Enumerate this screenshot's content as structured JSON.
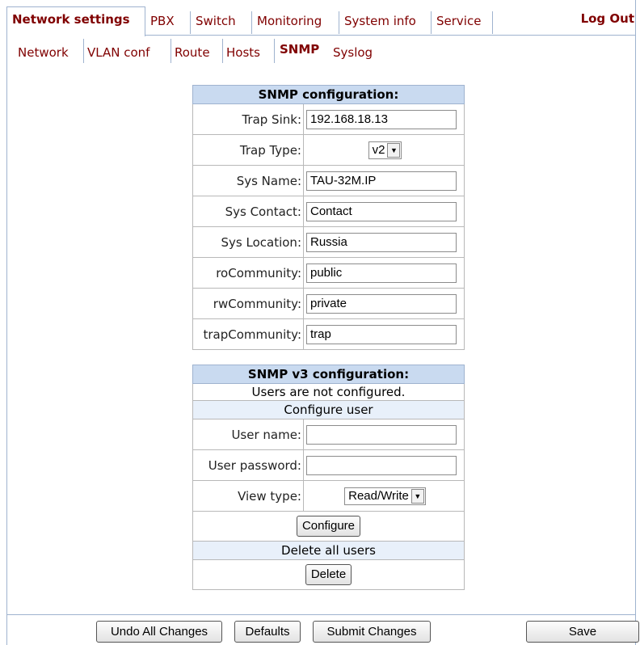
{
  "top_nav": {
    "tabs": [
      "Network settings",
      "PBX",
      "Switch",
      "Monitoring",
      "System info",
      "Service"
    ],
    "logout": "Log Out"
  },
  "sub_nav": {
    "tabs": [
      "Network",
      "VLAN conf",
      "Route",
      "Hosts",
      "SNMP",
      "Syslog"
    ]
  },
  "snmp": {
    "title": "SNMP configuration:",
    "trap_sink_label": "Trap Sink:",
    "trap_sink_value": "192.168.18.13",
    "trap_type_label": "Trap Type:",
    "trap_type_value": "v2",
    "sys_name_label": "Sys Name:",
    "sys_name_value": "TAU-32M.IP",
    "sys_contact_label": "Sys Contact:",
    "sys_contact_value": "Contact",
    "sys_location_label": "Sys Location:",
    "sys_location_value": "Russia",
    "ro_label": "roCommunity:",
    "ro_value": "public",
    "rw_label": "rwCommunity:",
    "rw_value": "private",
    "trap_comm_label": "trapCommunity:",
    "trap_comm_value": "trap"
  },
  "snmpv3": {
    "title": "SNMP v3 configuration:",
    "status": "Users are not configured.",
    "configure_user_header": "Configure user",
    "user_name_label": "User name:",
    "user_name_value": "",
    "user_password_label": "User password:",
    "user_password_value": "",
    "view_type_label": "View type:",
    "view_type_value": "Read/Write",
    "configure_button": "Configure",
    "delete_all_header": "Delete all users",
    "delete_button": "Delete"
  },
  "footer": {
    "undo": "Undo All Changes",
    "defaults": "Defaults",
    "submit": "Submit Changes",
    "save": "Save"
  }
}
